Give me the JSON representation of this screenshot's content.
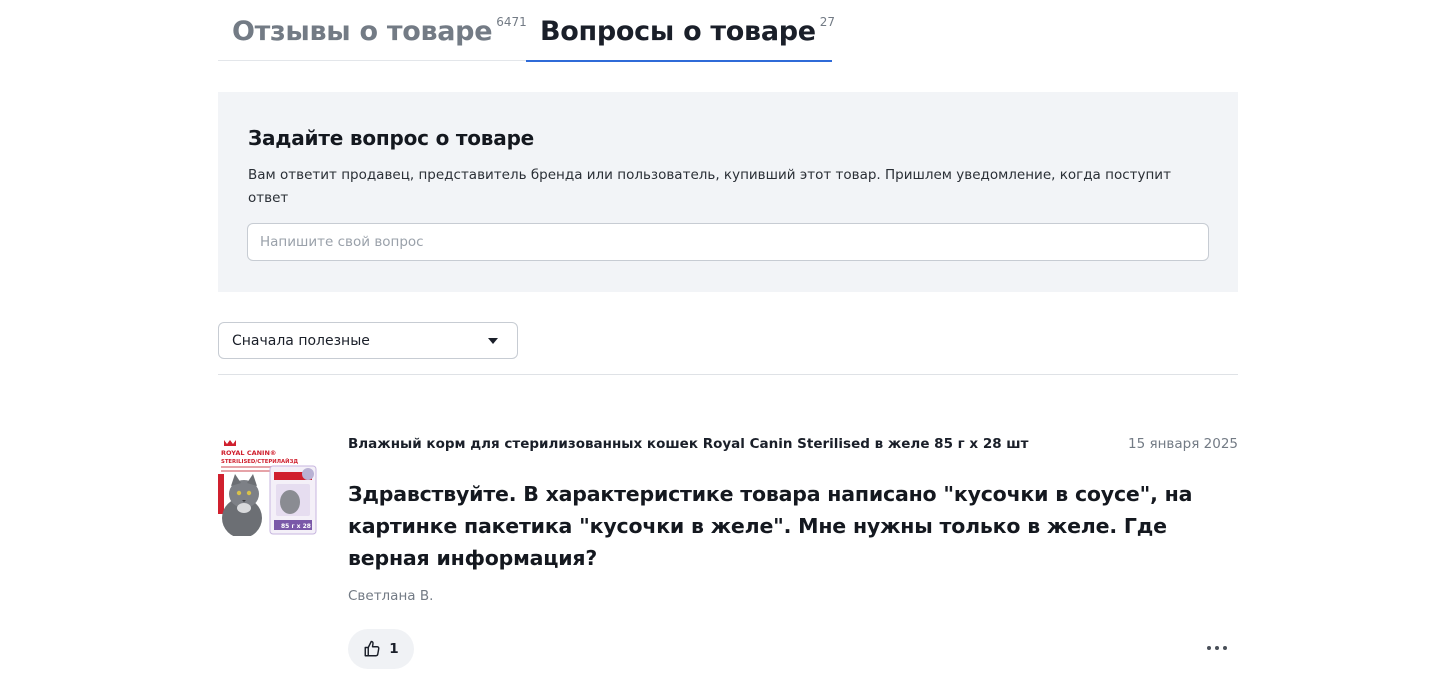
{
  "tabs": [
    {
      "label": "Отзывы о товаре",
      "count": "6471",
      "active": false
    },
    {
      "label": "Вопросы о товаре",
      "count": "27",
      "active": true
    }
  ],
  "ask": {
    "title": "Задайте вопрос о товаре",
    "description": "Вам ответит продавец, представитель бренда или пользователь, купивший этот товар. Пришлем уведомление, когда поступит ответ",
    "placeholder": "Напишите свой вопрос"
  },
  "sort": {
    "selected": "Сначала полезные"
  },
  "question": {
    "product": "Влажный корм для стерилизованных кошек Royal Canin Sterilised в желе 85 г х 28 шт",
    "date": "15 января 2025",
    "text": "Здравствуйте. В характеристике товара написано \"кусочки в соусе\", на картинке пакетика \"кусочки в желе\". Мне нужны только в желе. Где верная информация?",
    "author": "Светлана В.",
    "likes": "1",
    "thumbnail": {
      "brand": "ROYAL CANIN®",
      "line": "STERILISED/СТЕРИЛАЙЗД",
      "pack": "85 г х 28"
    }
  },
  "colors": {
    "accent": "#2f6bd8",
    "box_bg": "#f2f4f7",
    "muted_text": "#737b85",
    "brand_red": "#d0202e",
    "pack_purple": "#7a58a8"
  },
  "icons": {
    "like": "thumbs-up-icon",
    "more": "more-dots-icon",
    "caret": "chevron-down-icon"
  }
}
